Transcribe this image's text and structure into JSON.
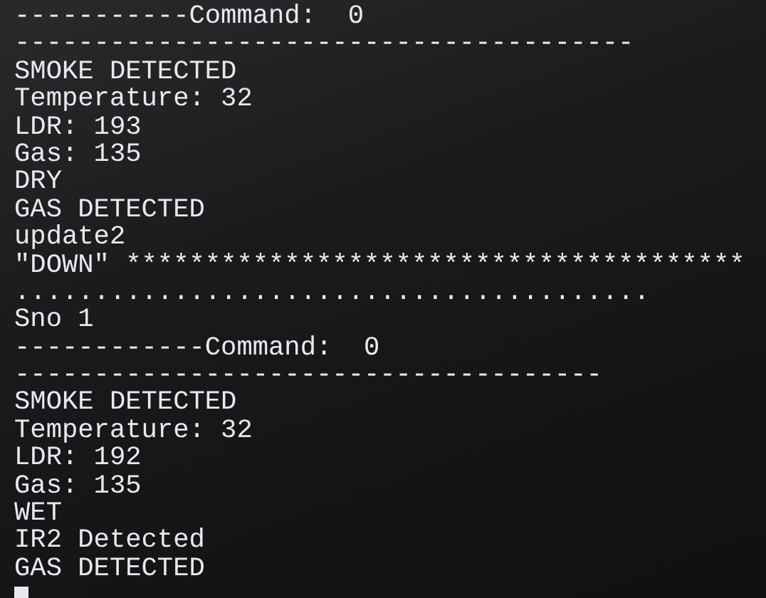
{
  "terminal": {
    "lines": [
      "-----------Command:  0",
      "---------------------------------------",
      "SMOKE DETECTED",
      "Temperature: 32",
      "LDR: 193",
      "Gas: 135",
      "DRY",
      "GAS DETECTED",
      "update2",
      "\"DOWN\" ***************************************",
      "........................................",
      "Sno 1",
      "------------Command:  0",
      "-------------------------------------",
      "SMOKE DETECTED",
      "Temperature: 32",
      "LDR: 192",
      "Gas: 135",
      "WET",
      "IR2 Detected",
      "GAS DETECTED"
    ]
  }
}
